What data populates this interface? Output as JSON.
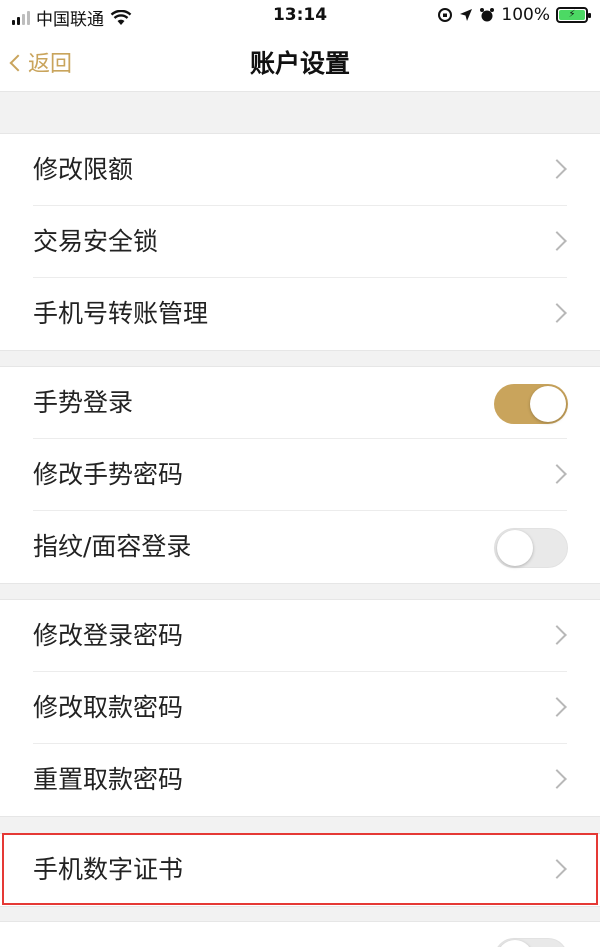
{
  "status_bar": {
    "carrier": "中国联通",
    "time": "13:14",
    "battery": "100%"
  },
  "nav": {
    "back_label": "返回",
    "title": "账户设置"
  },
  "groups": [
    {
      "items": [
        {
          "label": "修改限额",
          "control": "chevron"
        },
        {
          "label": "交易安全锁",
          "control": "chevron"
        },
        {
          "label": "手机号转账管理",
          "control": "chevron"
        }
      ]
    },
    {
      "items": [
        {
          "label": "手势登录",
          "control": "toggle",
          "on": true
        },
        {
          "label": "修改手势密码",
          "control": "chevron"
        },
        {
          "label": "指纹/面容登录",
          "control": "toggle",
          "on": false
        }
      ]
    },
    {
      "items": [
        {
          "label": "修改登录密码",
          "control": "chevron"
        },
        {
          "label": "修改取款密码",
          "control": "chevron"
        },
        {
          "label": "重置取款密码",
          "control": "chevron"
        }
      ]
    },
    {
      "items": [
        {
          "label": "手机数字证书",
          "control": "chevron"
        }
      ]
    }
  ],
  "colors": {
    "accent": "#c9a45c",
    "highlight": "#e53935",
    "toggle_off": "#e9e9e9"
  }
}
